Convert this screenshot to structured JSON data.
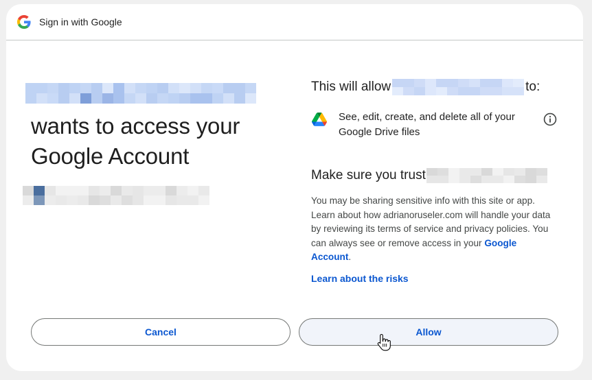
{
  "header": {
    "title": "Sign in with Google",
    "icon": "google-g-icon"
  },
  "main": {
    "headline_line1": "wants to access your",
    "headline_line2": "Google Account"
  },
  "permissions": {
    "intro_prefix": "This will allow",
    "intro_suffix": "to:",
    "scope_text": "See, edit, create, and delete all of your Google Drive files",
    "scope_icon": "google-drive-icon",
    "info_icon": "info-icon"
  },
  "trust": {
    "title": "Make sure you trust",
    "desc_before_link": "You may be sharing sensitive info with this site or app. Learn about how adrianoruseler.com will handle your data by reviewing its terms of service and privacy policies. You can always see or remove access in your ",
    "account_link": "Google Account",
    "desc_after_link": ".",
    "risks_link": "Learn about the risks"
  },
  "buttons": {
    "cancel": "Cancel",
    "allow": "Allow"
  },
  "colors": {
    "link_blue": "#0b57d0",
    "border": "#747775",
    "allow_bg": "#f1f4fa",
    "page_bg": "#f0f0f0"
  }
}
